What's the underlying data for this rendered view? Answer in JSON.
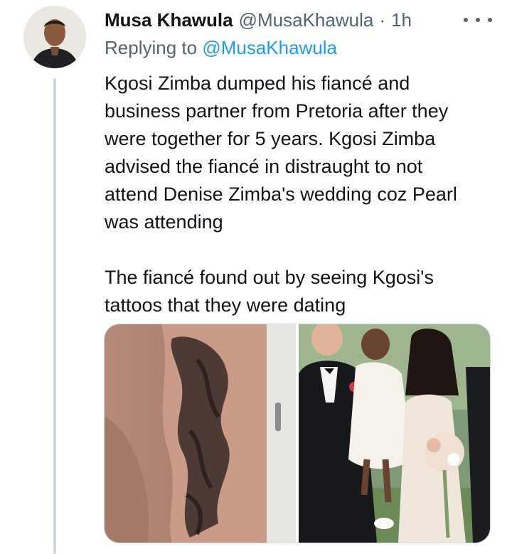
{
  "author": {
    "name": "Musa Khawula",
    "handle": "@MusaKhawula",
    "separator": "·",
    "time": "1h"
  },
  "replying": {
    "prefix": "Replying to",
    "mention": "@MusaKhawula"
  },
  "tweet": {
    "paragraph1": "Kgosi Zimba dumped his fiancé  and\nbusiness partner from Pretoria after they\nwere together for 5 years. Kgosi Zimba\nadvised the fiancé in distraught to not\nattend Denise Zimba's wedding coz Pearl\nwas attending",
    "paragraph2": "The fiancé found out by seeing Kgosi's\ntattoos that they were dating"
  },
  "icons": {
    "more": "more-horizontal-icon"
  },
  "colors": {
    "text": "#0f1419",
    "secondary": "#536471",
    "link": "#1d9bf0",
    "thread_line": "#cfd9de"
  }
}
